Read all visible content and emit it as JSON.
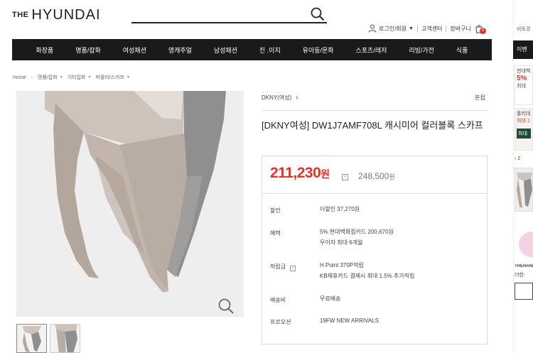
{
  "header": {
    "logo_prefix": "THE",
    "logo_brand": "HYUNDAI",
    "search_placeholder": "",
    "util": {
      "login": "로그인/회원",
      "support": "고객센터",
      "cart": "장바구니",
      "cart_count": "0"
    }
  },
  "gnb": [
    "화장품",
    "명품/잡화",
    "여성패션",
    "영캐주얼",
    "남성패션",
    "진 .이지",
    "유아동/문화",
    "스포츠/레저",
    "리빙/가전",
    "식품"
  ],
  "breadcrumb": [
    "Home",
    "명품/잡화",
    "기타잡화",
    "머플러/스카프"
  ],
  "product": {
    "brand_link": "DKNY(여성)",
    "store": "본점",
    "title": "[DKNY여성] DW1J7AMF708L 캐시미어 컬러블록 스카프",
    "price_now": "211,230",
    "price_now_unit": "원",
    "price_org": "248,500",
    "price_org_unit": "원",
    "rows": [
      {
        "label": "할인",
        "lines": [
          "더할인 37,270원"
        ]
      },
      {
        "label": "혜택",
        "lines": [
          "5% 현대백화점카드 200,670원",
          "무이자 최대 6개월"
        ]
      },
      {
        "label": "적립금",
        "lines": [
          "H.Point 370P적립",
          "KB제휴카드 결제시 최대 1.5% 추가적립"
        ]
      },
      {
        "label": "배송비",
        "lines": [
          "무료배송"
        ]
      },
      {
        "label": "프로모션",
        "lines": [
          "19FW NEW ARRIVALS"
        ]
      }
    ]
  },
  "side": {
    "compare": "비토경",
    "dark_label": "이벤",
    "card1_lines": [
      "현대백",
      "5%",
      "최대"
    ],
    "card2_lines": [
      "홀리데",
      "최대 1",
      "최대"
    ],
    "pager": "‹ 2",
    "brand_text": "THEHAND",
    "brand_sub": "더한·"
  },
  "colors": {
    "accent_red": "#e8302a",
    "gnb_bg": "#1a1a1a"
  }
}
